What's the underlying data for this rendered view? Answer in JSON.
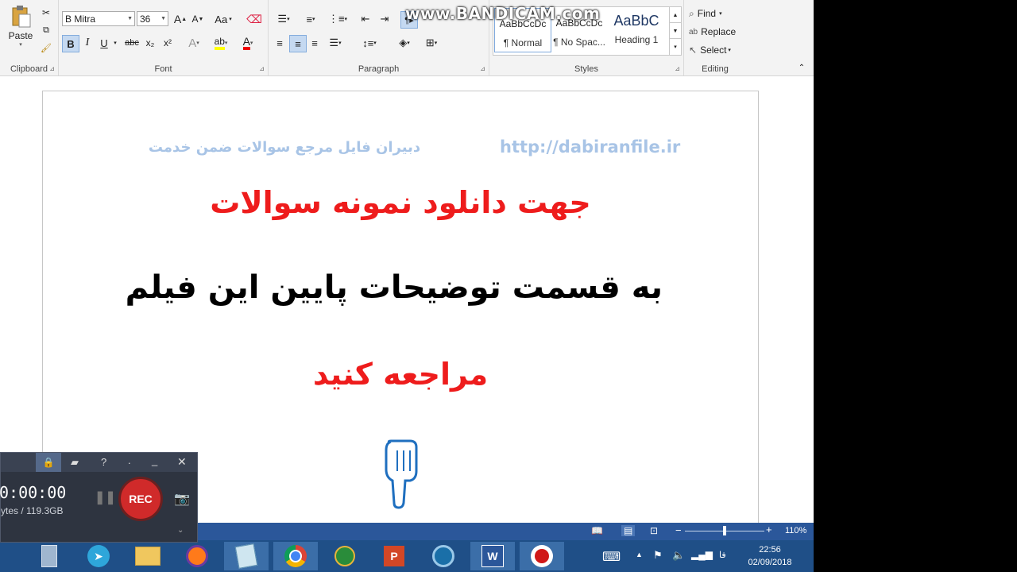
{
  "ribbon": {
    "clipboard": {
      "label": "Clipboard",
      "paste": "Paste"
    },
    "font": {
      "label": "Font",
      "family": "B Mitra",
      "size": "36",
      "change_case": "Aa",
      "bold": "B",
      "italic": "I",
      "underline": "U",
      "strike": "abc",
      "subscript": "x₂",
      "superscript": "x²"
    },
    "paragraph": {
      "label": "Paragraph"
    },
    "styles": {
      "label": "Styles",
      "items": [
        {
          "preview": "AaBbCcDc",
          "name": "¶ Normal"
        },
        {
          "preview": "AaBbCcDc",
          "name": "¶ No Spac..."
        },
        {
          "preview": "AaBbC",
          "name": "Heading 1"
        }
      ]
    },
    "editing": {
      "label": "Editing",
      "find": "Find",
      "replace": "Replace",
      "select": "Select"
    }
  },
  "watermark": "www.BANDICAM.com",
  "document": {
    "header_right_url": "http://dabiranfile.ir",
    "header_left": "دبیران فایل مرجع سوالات ضمن خدمت",
    "line1": "جهت دانلود نمونه سوالات",
    "line2": "به قسمت توضیحات پایین این فیلم",
    "line3": "مراجعه کنید",
    "colors": {
      "header": "#a8c4e6",
      "red": "#ee1c1c",
      "black": "#000000",
      "hand": "#1f6fbf"
    }
  },
  "statusbar": {
    "zoom": "110%"
  },
  "bandicam": {
    "timer": "0:00:00",
    "storage": "ytes / 119.3GB",
    "rec": "REC"
  },
  "taskbar": {
    "lang": "فا",
    "time": "22:56",
    "date": "02/09/2018"
  }
}
